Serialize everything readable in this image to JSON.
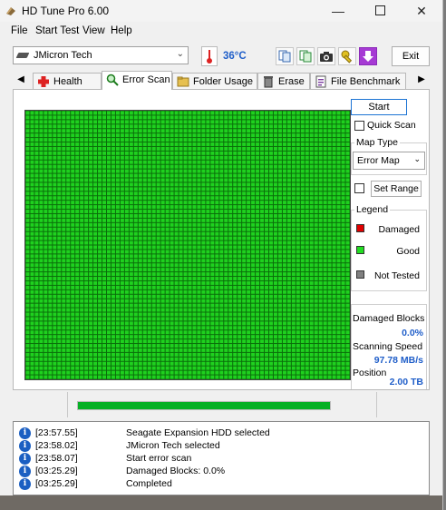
{
  "window": {
    "title": "HD Tune Pro 6.00"
  },
  "menu": [
    "File",
    "Start Test",
    "View",
    "Help"
  ],
  "toolbar": {
    "drive": "JMicron Tech",
    "temperature": "36°C",
    "exit_label": "Exit"
  },
  "tabs": [
    {
      "label": "Health",
      "icon": "health-icon"
    },
    {
      "label": "Error Scan",
      "icon": "magnifier-icon",
      "active": true
    },
    {
      "label": "Folder Usage",
      "icon": "folder-icon"
    },
    {
      "label": "Erase",
      "icon": "trash-icon"
    },
    {
      "label": "File Benchmark",
      "icon": "file-benchmark-icon"
    }
  ],
  "controls": {
    "start_label": "Start",
    "quick_scan_label": "Quick Scan",
    "map_type_label": "Map Type",
    "map_type_value": "Error Map",
    "set_range_label": "Set Range"
  },
  "legend": {
    "title": "Legend",
    "items": [
      {
        "label": "Damaged",
        "color": "#e00000"
      },
      {
        "label": "Good",
        "color": "#22dd22"
      },
      {
        "label": "Not Tested",
        "color": "#808080"
      }
    ]
  },
  "stats": {
    "damaged_label": "Damaged Blocks",
    "damaged_value": "0.0%",
    "speed_label": "Scanning Speed",
    "speed_value": "97.78 MB/s",
    "position_label": "Position",
    "position_value": "2.00 TB"
  },
  "scan": {
    "cell_color": "#1fd11f",
    "grid_color": "#0a6e0a",
    "progress_fraction": 1.0
  },
  "log": [
    {
      "time": "[23:57.55]",
      "message": "Seagate Expansion HDD selected"
    },
    {
      "time": "[23:58.02]",
      "message": "JMicron Tech selected"
    },
    {
      "time": "[23:58.07]",
      "message": "Start error scan"
    },
    {
      "time": "[03:25.29]",
      "message": "Damaged Blocks: 0.0%"
    },
    {
      "time": "[03:25.29]",
      "message": "Completed"
    }
  ],
  "colors": {
    "accent": "#1f5ec9",
    "progress": "#06b025"
  }
}
